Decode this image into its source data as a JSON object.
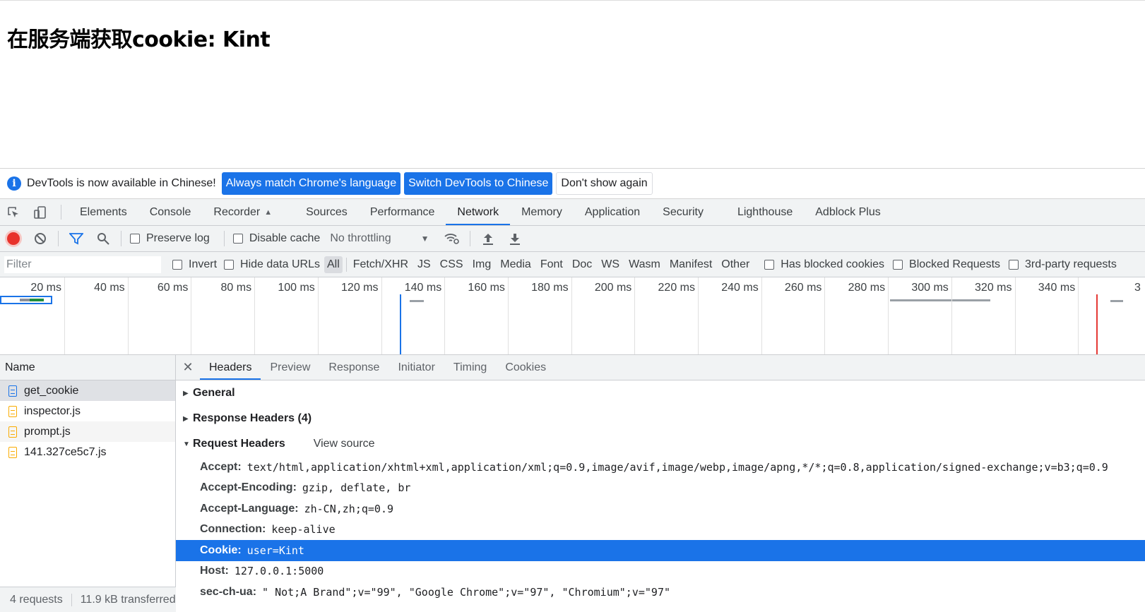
{
  "page": {
    "heading": "在服务端获取cookie: Kint"
  },
  "infobar": {
    "message": "DevTools is now available in Chinese!",
    "btn_match": "Always match Chrome's language",
    "btn_switch": "Switch DevTools to Chinese",
    "btn_dismiss": "Don't show again"
  },
  "tabs": [
    "Elements",
    "Console",
    "Recorder",
    "Sources",
    "Performance",
    "Network",
    "Memory",
    "Application",
    "Security",
    "Lighthouse",
    "Adblock Plus"
  ],
  "active_tab": "Network",
  "toolbar": {
    "preserve_log": "Preserve log",
    "disable_cache": "Disable cache",
    "throttling": "No throttling"
  },
  "filterbar": {
    "placeholder": "Filter",
    "invert": "Invert",
    "hide_data_urls": "Hide data URLs",
    "types": [
      "All",
      "Fetch/XHR",
      "JS",
      "CSS",
      "Img",
      "Media",
      "Font",
      "Doc",
      "WS",
      "Wasm",
      "Manifest",
      "Other"
    ],
    "has_blocked_cookies": "Has blocked cookies",
    "blocked_requests": "Blocked Requests",
    "third_party": "3rd-party requests"
  },
  "timeline": {
    "ticks": [
      "20 ms",
      "40 ms",
      "60 ms",
      "80 ms",
      "100 ms",
      "120 ms",
      "140 ms",
      "160 ms",
      "180 ms",
      "200 ms",
      "220 ms",
      "240 ms",
      "260 ms",
      "280 ms",
      "300 ms",
      "320 ms",
      "340 ms"
    ]
  },
  "requests": {
    "header": "Name",
    "items": [
      {
        "name": "get_cookie",
        "type": "doc"
      },
      {
        "name": "inspector.js",
        "type": "js"
      },
      {
        "name": "prompt.js",
        "type": "js"
      },
      {
        "name": "141.327ce5c7.js",
        "type": "js"
      }
    ],
    "count": "4 requests",
    "transferred": "11.9 kB transferred"
  },
  "detail": {
    "tabs": [
      "Headers",
      "Preview",
      "Response",
      "Initiator",
      "Timing",
      "Cookies"
    ],
    "general": "General",
    "response_headers": "Response Headers (4)",
    "request_headers": "Request Headers",
    "view_source": "View source",
    "headers": [
      {
        "k": "Accept:",
        "v": "text/html,application/xhtml+xml,application/xml;q=0.9,image/avif,image/webp,image/apng,*/*;q=0.8,application/signed-exchange;v=b3;q=0.9"
      },
      {
        "k": "Accept-Encoding:",
        "v": "gzip, deflate, br"
      },
      {
        "k": "Accept-Language:",
        "v": "zh-CN,zh;q=0.9"
      },
      {
        "k": "Connection:",
        "v": "keep-alive"
      },
      {
        "k": "Cookie:",
        "v": "user=Kint"
      },
      {
        "k": "Host:",
        "v": "127.0.0.1:5000"
      },
      {
        "k": "sec-ch-ua:",
        "v": "\" Not;A Brand\";v=\"99\", \"Google Chrome\";v=\"97\", \"Chromium\";v=\"97\""
      }
    ]
  }
}
